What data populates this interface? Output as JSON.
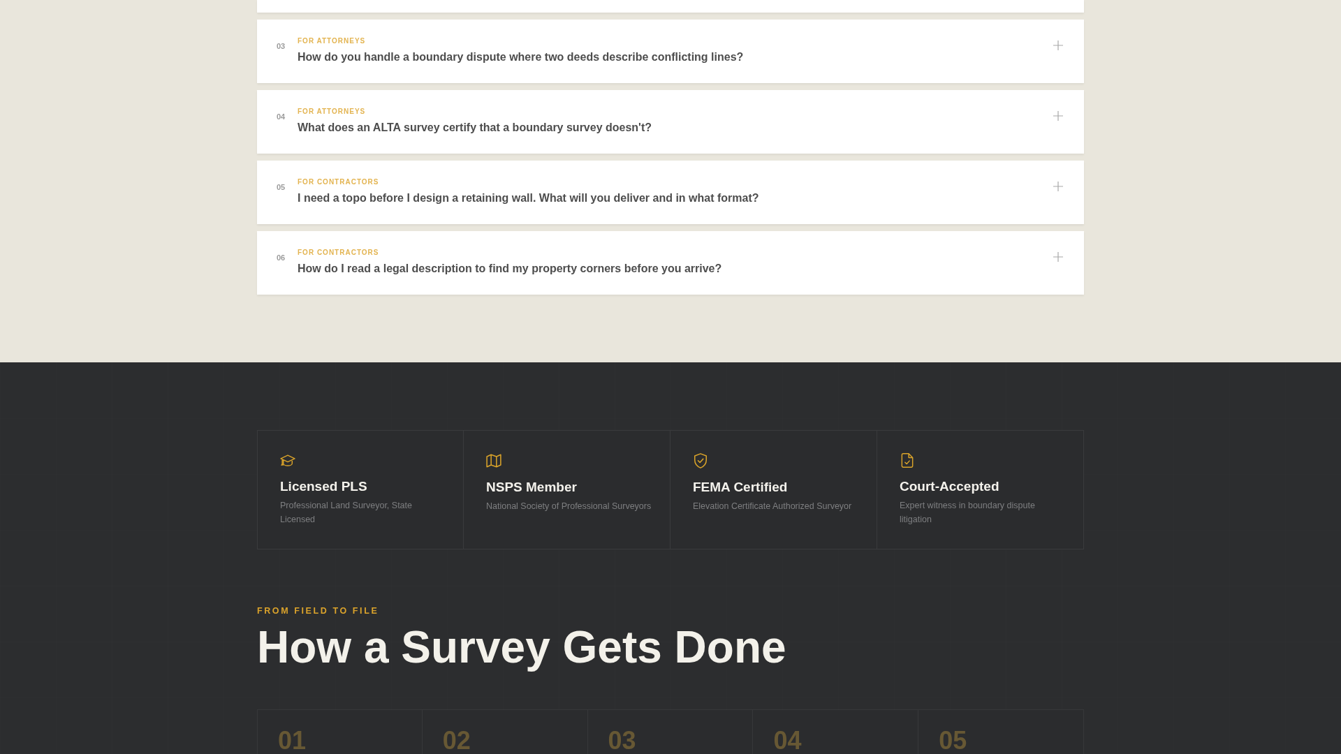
{
  "faq": {
    "items": [
      {
        "number": "03",
        "category": "FOR ATTORNEYS",
        "question": "How do you handle a boundary dispute where two deeds describe conflicting lines?",
        "expanded": false
      },
      {
        "number": "04",
        "category": "FOR ATTORNEYS",
        "question": "What does an ALTA survey certify that a boundary survey doesn't?",
        "expanded": false
      },
      {
        "number": "05",
        "category": "FOR CONTRACTORS",
        "question": "I need a topo before I design a retaining wall. What will you deliver and in what format?",
        "expanded": false
      },
      {
        "number": "06",
        "category": "FOR CONTRACTORS",
        "question": "How do I read a legal description to find my property corners before you arrive?",
        "expanded": false
      }
    ]
  },
  "credentials": [
    {
      "title": "Licensed PLS",
      "description": "Professional Land Surveyor, State Licensed"
    },
    {
      "title": "NSPS Member",
      "description": "National Society of Professional Surveyors"
    },
    {
      "title": "FEMA Certified",
      "description": "Elevation Certificate Authorized Surveyor"
    },
    {
      "title": "Court-Accepted",
      "description": "Expert witness in boundary dispute litigation"
    }
  ],
  "process": {
    "eyebrow": "FROM FIELD TO FILE",
    "title": "How a Survey Gets Done",
    "steps": [
      {
        "number": "01"
      },
      {
        "number": "02"
      },
      {
        "number": "03"
      },
      {
        "number": "04"
      },
      {
        "number": "05"
      }
    ]
  }
}
